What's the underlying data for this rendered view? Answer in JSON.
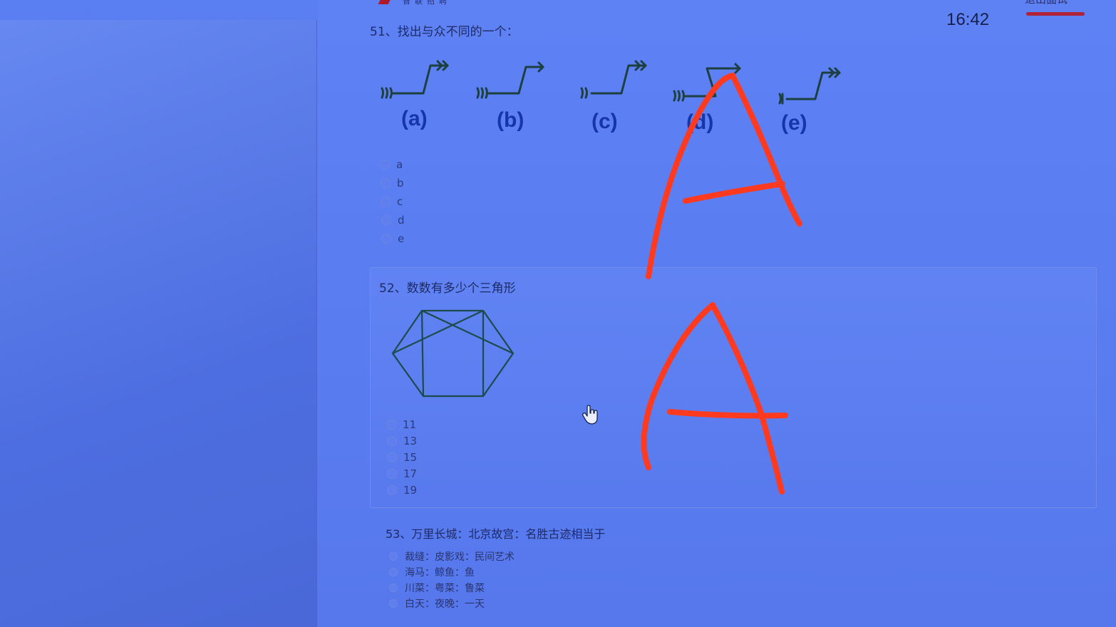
{
  "header": {
    "logo_text": "智联招聘",
    "clock": "16:42",
    "exit_label": "退出面试"
  },
  "q51": {
    "title": "51、找出与众不同的一个：",
    "figure_labels": [
      "(a)",
      "(b)",
      "(c)",
      "(d)",
      "(e)"
    ],
    "options": [
      "a",
      "b",
      "c",
      "d",
      "e"
    ]
  },
  "q52": {
    "title": "52、数数有多少个三角形",
    "options": [
      "11",
      "13",
      "15",
      "17",
      "19"
    ]
  },
  "q53": {
    "title": "53、万里长城：北京故宫：名胜古迹相当于",
    "options": [
      "裁缝：皮影戏：民间艺术",
      "海马：鲸鱼：鱼",
      "川菜：粤菜：鲁菜",
      "白天：夜晚：一天"
    ]
  },
  "handwriting": {
    "color": "#ff3a1e",
    "marks": [
      "A",
      "A"
    ]
  }
}
